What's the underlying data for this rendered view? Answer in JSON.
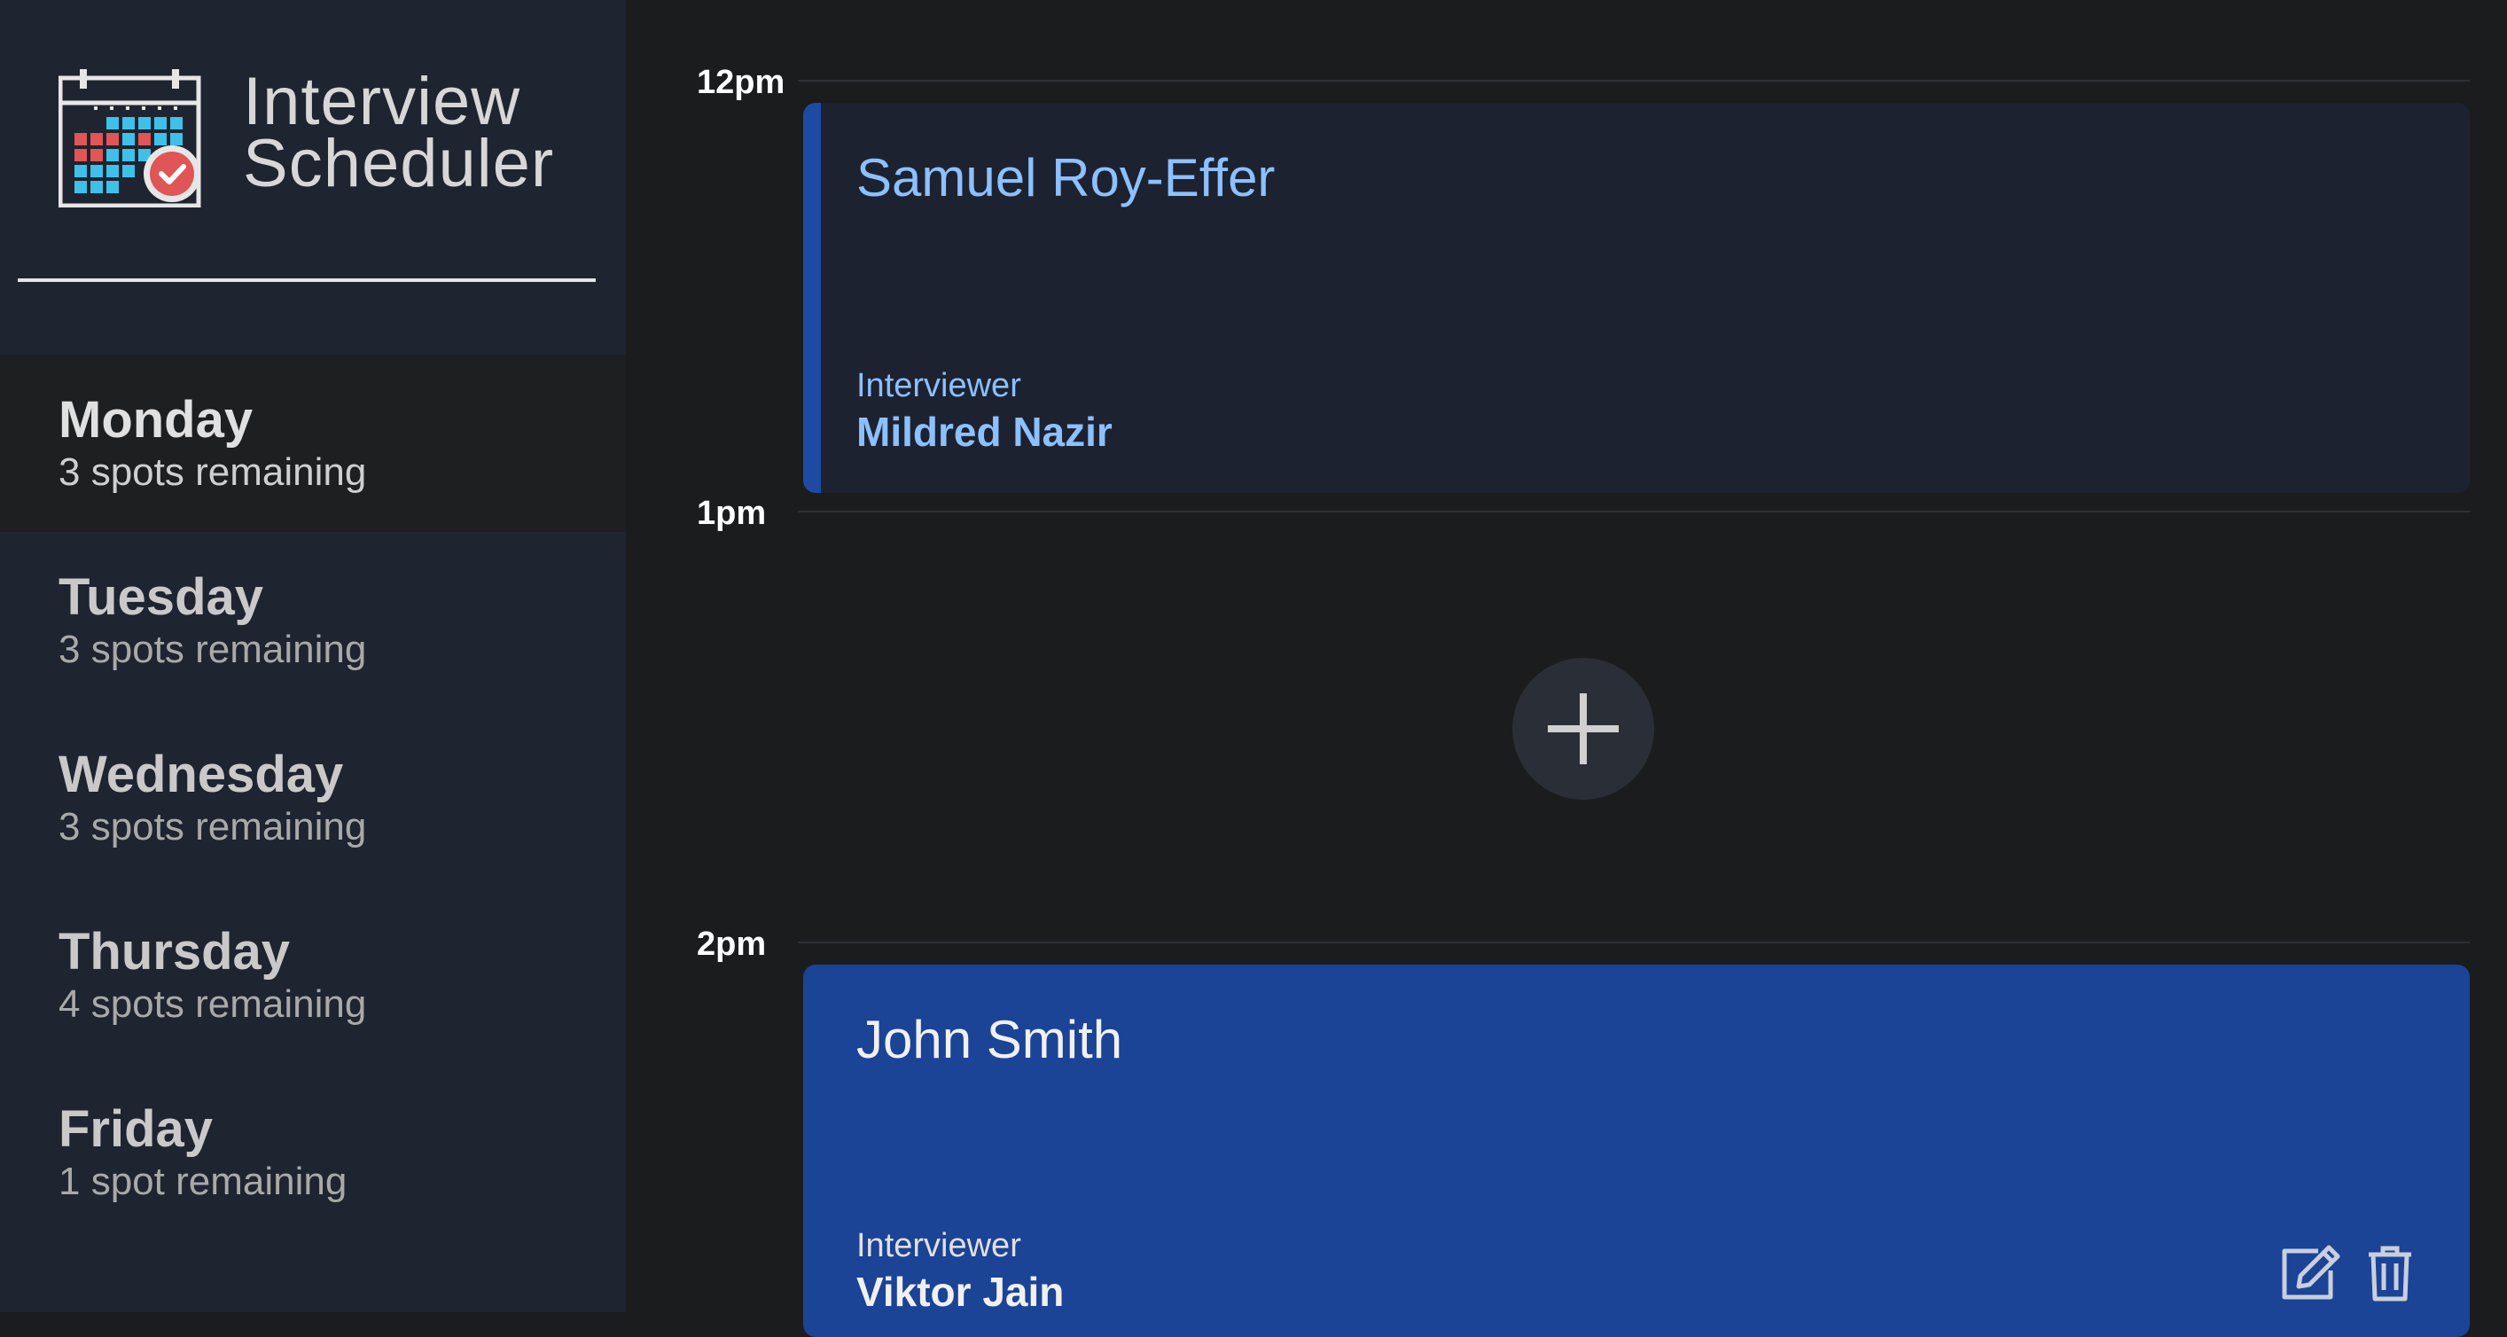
{
  "app": {
    "title_line1": "Interview",
    "title_line2": "Scheduler",
    "logo_icon": "calendar-check-icon"
  },
  "days": [
    {
      "name": "Monday",
      "spots": "3 spots remaining",
      "selected": true
    },
    {
      "name": "Tuesday",
      "spots": "3 spots remaining",
      "selected": false
    },
    {
      "name": "Wednesday",
      "spots": "3 spots remaining",
      "selected": false
    },
    {
      "name": "Thursday",
      "spots": "4 spots remaining",
      "selected": false
    },
    {
      "name": "Friday",
      "spots": "1 spot remaining",
      "selected": false
    }
  ],
  "schedule": {
    "times": [
      "12pm",
      "1pm",
      "2pm"
    ],
    "appointments": [
      {
        "student": "Samuel Roy-Effer",
        "interviewer_label": "Interviewer",
        "interviewer": "Mildred Nazir"
      },
      {
        "add_icon": "plus-icon"
      },
      {
        "student": "John Smith",
        "interviewer_label": "Interviewer",
        "interviewer": "Viktor Jain",
        "edit_icon": "edit-icon",
        "delete_icon": "trash-icon"
      }
    ]
  },
  "colors": {
    "sidebar_bg": "#1e2430",
    "main_bg": "#1b1c1e",
    "accent": "#1b4396",
    "accent_text": "#8cc0ff"
  }
}
